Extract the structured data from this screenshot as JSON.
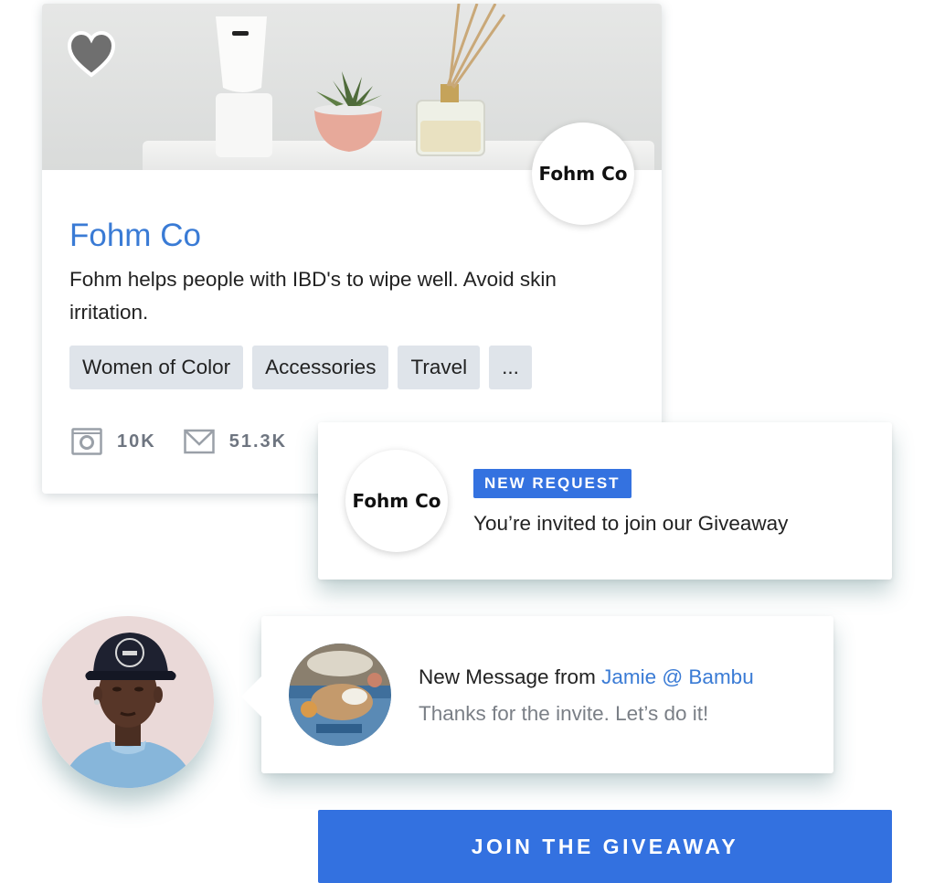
{
  "brand": {
    "name": "Fohm Co",
    "logo_text": "Fohm Co",
    "description": "Fohm helps people with IBD's to wipe well. Avoid skin irritation.",
    "tags": [
      "Women of Color",
      "Accessories",
      "Travel",
      "..."
    ],
    "stats": [
      {
        "icon": "instagram-icon",
        "value": "10K"
      },
      {
        "icon": "mail-icon",
        "value": "51.3K"
      }
    ],
    "favorite_icon": "heart-icon"
  },
  "request": {
    "logo_text": "Fohm Co",
    "badge": "NEW REQUEST",
    "text": "You’re invited to join our Giveaway"
  },
  "message": {
    "title_prefix": "New Message from ",
    "sender": "Jamie @ Bambu",
    "body": "Thanks for the invite. Let’s do it!"
  },
  "cta": {
    "label": "JOIN THE GIVEAWAY"
  },
  "colors": {
    "accent": "#3371e0",
    "link": "#3a7bd5",
    "tag_bg": "#dfe4ea",
    "muted_text": "#7a7f86"
  }
}
